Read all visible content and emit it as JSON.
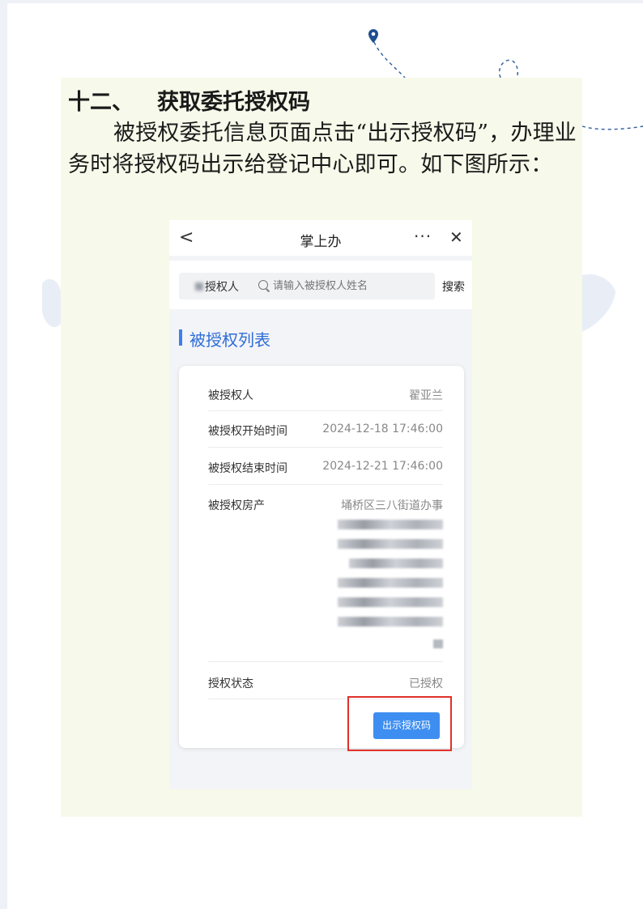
{
  "doc": {
    "heading_num": "十二、",
    "heading_text": "获取委托授权码",
    "paragraph": "被授权委托信息页面点击“出示授权码”，办理业务时将授权码出示给登记中心即可。如下图所示："
  },
  "phone": {
    "nav": {
      "back_icon": "<",
      "title": "掌上办",
      "more_icon": "···",
      "close_icon": "✕"
    },
    "search": {
      "label": "授权人",
      "placeholder": "请输入被授权人姓名",
      "button": "搜索"
    },
    "section_title": "被授权列表",
    "card": {
      "grantee_label": "被授权人",
      "grantee_value": "翟亚兰",
      "start_label": "被授权开始时间",
      "start_value": "2024-12-18 17:46:00",
      "end_label": "被授权结束时间",
      "end_value": "2024-12-21 17:46:00",
      "property_label": "被授权房产",
      "property_value": "埇桥区三八街道办事",
      "status_label": "授权状态",
      "status_value": "已授权",
      "show_button": "出示授权码"
    }
  },
  "colors": {
    "accent": "#3d8ef0",
    "title_blue": "#2e6dd8",
    "highlight_red": "#e0302a",
    "content_bg": "#f7f9ea"
  }
}
